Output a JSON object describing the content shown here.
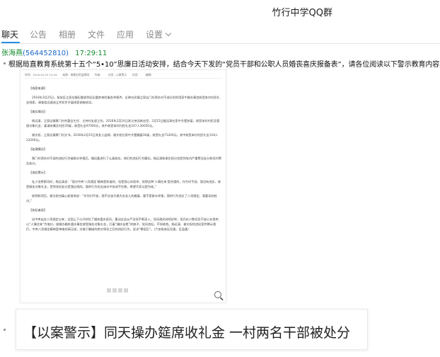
{
  "window": {
    "title": "竹行中学QQ群"
  },
  "tabs": [
    {
      "label": "聊天",
      "active": true
    },
    {
      "label": "公告"
    },
    {
      "label": "相册"
    },
    {
      "label": "文件"
    },
    {
      "label": "应用"
    },
    {
      "label": "设置"
    }
  ],
  "message": {
    "sender": "张海燕",
    "qq": "(564452810)",
    "time": "17:29:11",
    "text": "根据局直教育系统第十五个“5•10”思廉日活动安排，结合今天下发的“党员干部和公职人员婚丧喜庆报备表”，请各位阅读以下警示教育内容，"
  },
  "document": {
    "meta": "时间：2016-05-23 14:44　　来源：南都纪检监察网　　作者：　　分类：以案警示　　浏览：　　编辑：",
    "sections": [
      {
        "heading": "【线索来源】",
        "paragraphs": [
          "2016年3月25日，裕安区江家店镇纪委收到区纪委转来的服务举报件，反映仪凤镇江家店门村两名村干部分别利用家中操办事宜收受本村村民礼金线索。调查组迅速成立并初步开展线索调查核实。"
        ]
      },
      {
        "heading": "【查实情况】",
        "paragraphs": [
          "杨远清，江家店镇黄门村村委会主任、主持村支部工作。2016年2月14日其父亲因病去世，2月15日据远清在家中大摆丧宴，收受本村村民及管理对象礼金，宴请亲属及村民29桌，收受礼金97000元，其中收受本村村民礼金147人30050元。",
          "谢文权，江家店镇黄门村文书。2016年2月15日其女儿出嫁，谢文权在家中大摆婚宴30桌，收受礼金71200元，其中收受本村村民礼金118人23200元。"
        ]
      },
      {
        "heading": "【处理情况】",
        "paragraphs": [
          "黄门村两名村干部的违纪行为被群众举报后，镇纪委进行了认真核实，他们的违纪行为属实。杨远清和谢文权分别受到党内严重警告处分和党内警告处分。"
        ]
      },
      {
        "heading": "【违纪警示】",
        "paragraphs": [
          "杜少浓更斯司时，杨远清说：“我对中央‘八项规定’精神是知道的，但是我心存侥幸，觉得这种‘人情往来’是合理的，作为村干部，我没有违反，收受服务对象礼金，受到党纪处分是我自找的。我的行为也告诫众中各成不在数，希望大家以我为戒。”",
          "收到款项后，谢文权也痛心疾首地说：“作为村干部，我不应该大操大办女儿的婚宴，要不是群众举报，我的行为违反了八项规定，我要深刻检讨。”"
        ]
      },
      {
        "heading": "【执纪者说】",
        "paragraphs": [
          "自中央出台八项规定以来，全国上下公开刹住了婚丧喜庆歪风，重动全县从严治党不断深入，党风政风持续好转，但仍存少数党员干部心存侥幸、以“人情往来”为借口，借操办婚丧喜庆事宜收受服务对象礼金，打着“婚庆自愿”的旗子，党风违纪。不知收敛。杨远清、谢文权的违纪案件教示我们，中央八项规定精神是带电的高压线，对敢于触碰的绝对领导之后的违纪行为，坚决“零容忍”。（六安裕安区纪委、区监委）"
        ]
      }
    ]
  },
  "link_card": {
    "title": "【以案警示】同天操办筵席收礼金 一村两名干部被处分"
  }
}
